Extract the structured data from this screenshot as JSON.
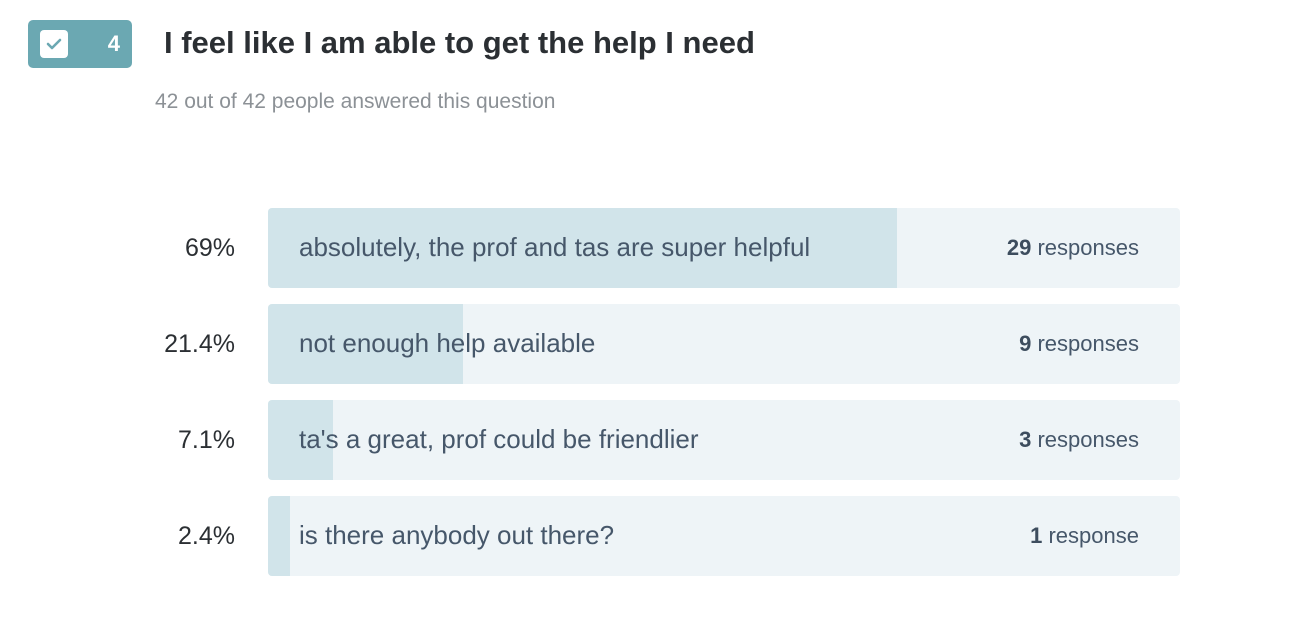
{
  "question": {
    "number": "4",
    "title": "I feel like I am able to get the help I need",
    "subtitle": "42 out of 42 people answered this question",
    "badge_icon": "checkbox-icon"
  },
  "colors": {
    "badge": "#6ba8b2",
    "bar_fill": "#d1e4ea",
    "bar_track": "#eef4f7"
  },
  "chart_data": {
    "type": "bar",
    "orientation": "horizontal",
    "title": "I feel like I am able to get the help I need",
    "categories": [
      "absolutely, the prof and tas are super helpful",
      "not enough help available",
      "ta's a great, prof could be friendlier",
      "is there anybody out there?"
    ],
    "series": [
      {
        "values": [
          69,
          21.4,
          7.1,
          2.4
        ]
      }
    ],
    "percent_labels": [
      "69%",
      "21.4%",
      "7.1%",
      "2.4%"
    ],
    "counts": [
      29,
      9,
      3,
      1
    ],
    "count_units": [
      "responses",
      "responses",
      "responses",
      "response"
    ],
    "xlim": [
      0,
      100
    ]
  }
}
